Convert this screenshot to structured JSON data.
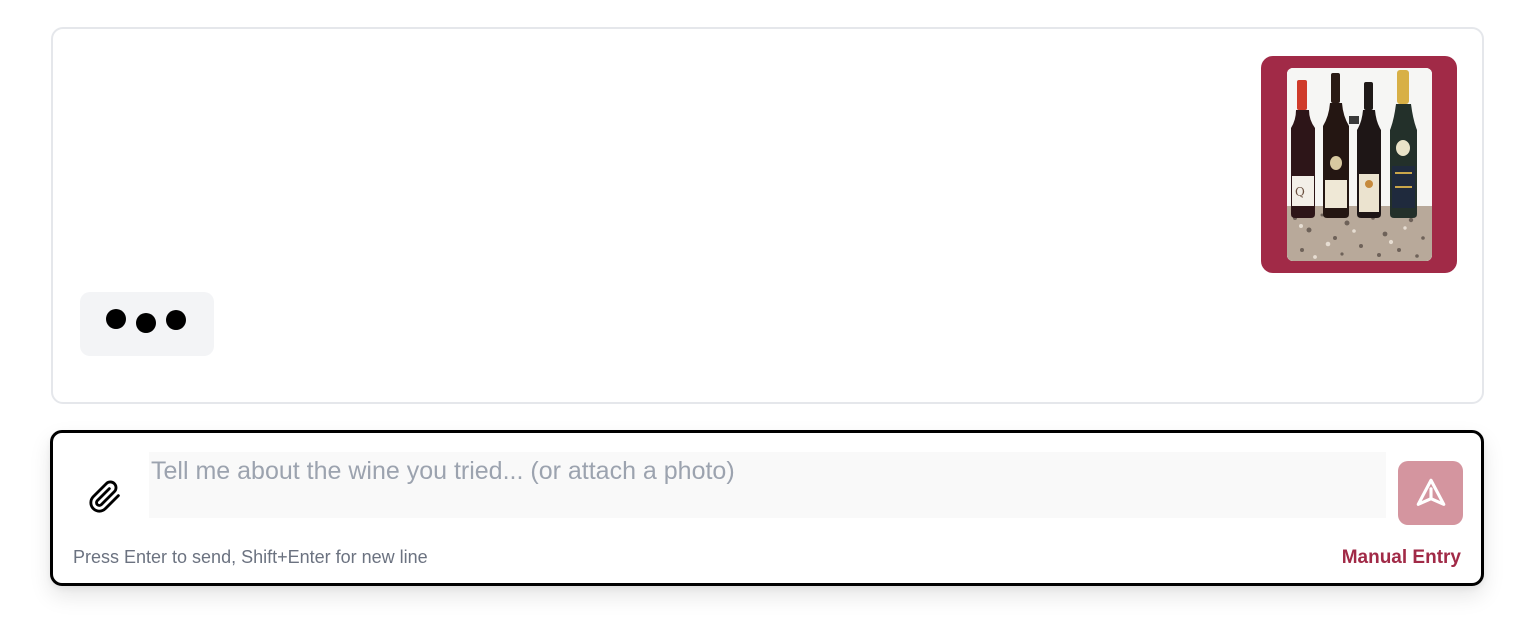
{
  "chat": {
    "messages": [
      {
        "role": "user",
        "kind": "photo",
        "image": "wine-bottles-photo"
      },
      {
        "role": "assistant",
        "kind": "typing-indicator"
      }
    ]
  },
  "composer": {
    "attach_icon": "paperclip-icon",
    "input_value": "",
    "input_placeholder": "Tell me about the wine you tried... (or attach a photo)",
    "send_icon": "send-icon",
    "hint": "Press Enter to send, Shift+Enter for new line",
    "manual_entry_label": "Manual Entry"
  },
  "colors": {
    "accent": "#a12a47",
    "send_button_disabled": "#d4959f",
    "panel_border": "#e5e7eb",
    "input_border": "#000000",
    "typing_bubble": "#f3f4f6",
    "hint": "#6b7280"
  }
}
